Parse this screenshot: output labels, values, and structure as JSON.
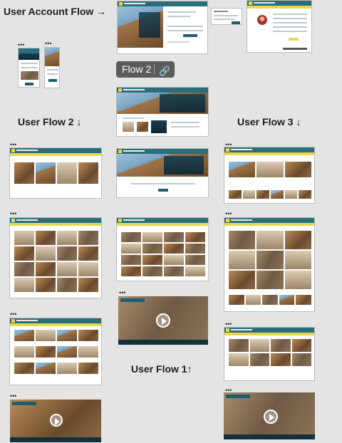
{
  "labels": {
    "user_account_flow": "User Account Flow →",
    "flow2_chip": "Flow 2",
    "user_flow_2": "User Flow 2 ↓",
    "user_flow_3": "User Flow 3 ↓",
    "user_flow_1": "User Flow 1↑"
  },
  "icons": {
    "link": "link-icon",
    "play": "play-icon",
    "menu": "more-options-icon"
  },
  "dots": "•••",
  "colors": {
    "header": "#2b6d78",
    "nav": "#e6d94f",
    "canvas": "#e4e4e4",
    "chip": "#5b5b5b"
  }
}
